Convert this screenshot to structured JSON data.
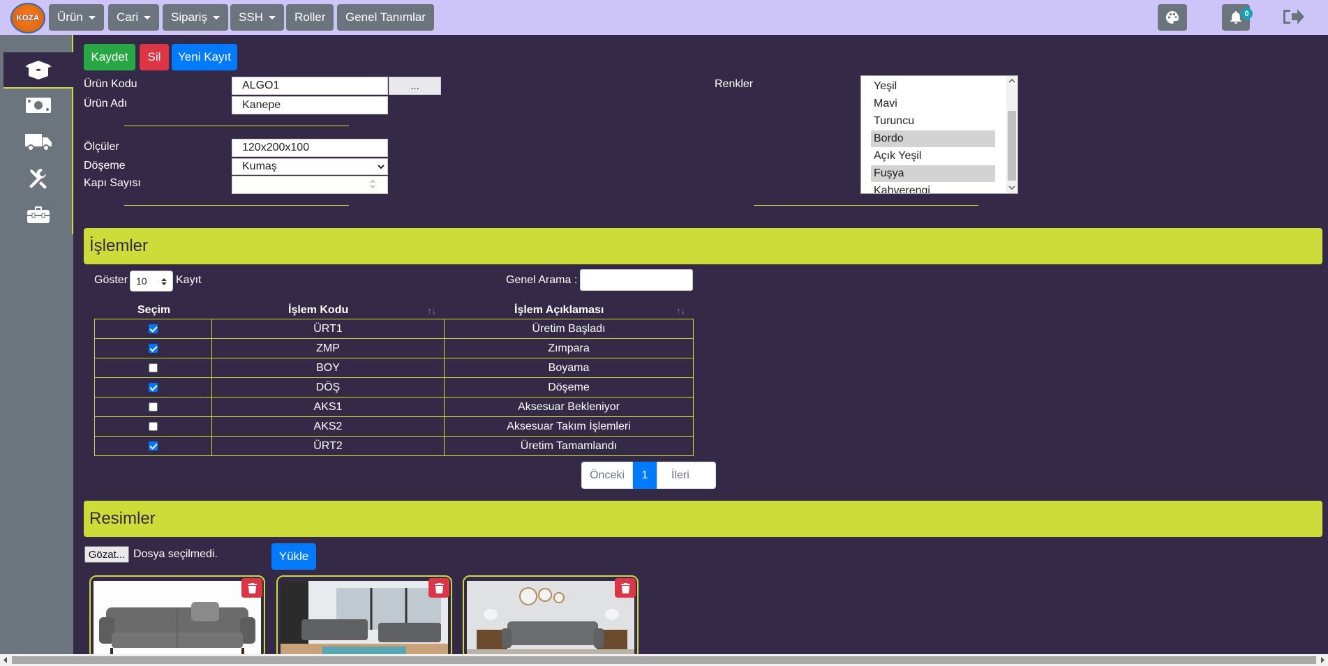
{
  "navbar": {
    "logo_text": "KOZA",
    "menus": [
      {
        "label": "Ürün",
        "dropdown": true
      },
      {
        "label": "Cari",
        "dropdown": true
      },
      {
        "label": "Sipariş",
        "dropdown": true
      },
      {
        "label": "SSH",
        "dropdown": true
      },
      {
        "label": "Roller",
        "dropdown": false
      },
      {
        "label": "Genel Tanımlar",
        "dropdown": false
      }
    ],
    "notification_count": "0",
    "icons": [
      "palette-icon",
      "bell-icon",
      "logout-icon"
    ]
  },
  "sidebar": {
    "items": [
      "box-open-icon",
      "money-bill-icon",
      "truck-icon",
      "tools-icon",
      "toolbox-icon"
    ],
    "active_index": 0
  },
  "toolbar": {
    "save_label": "Kaydet",
    "delete_label": "Sil",
    "new_label": "Yeni Kayıt"
  },
  "form": {
    "product_code_label": "Ürün Kodu",
    "product_code_value": "ALGO1",
    "browse_button": "...",
    "product_name_label": "Ürün Adı",
    "product_name_value": "Kanepe",
    "dimensions_label": "Ölçüler",
    "dimensions_value": "120x200x100",
    "upholstery_label": "Döşeme",
    "upholstery_value": "Kumaş",
    "door_count_label": "Kapı Sayısı",
    "door_count_value": "",
    "colors_label": "Renkler",
    "colors": [
      {
        "label": "Yeşil",
        "selected": false
      },
      {
        "label": "Mavi",
        "selected": false
      },
      {
        "label": "Turuncu",
        "selected": false
      },
      {
        "label": "Bordo",
        "selected": true
      },
      {
        "label": "Açık Yeşil",
        "selected": false
      },
      {
        "label": "Fuşya",
        "selected": true
      },
      {
        "label": "Kahverengi",
        "selected": false
      }
    ]
  },
  "operations": {
    "title": "İşlemler",
    "show_label": "Göster",
    "page_size": "10",
    "records_label": "Kayıt",
    "search_label": "Genel Arama :",
    "search_value": "",
    "columns": [
      "Seçim",
      "İşlem Kodu",
      "İşlem Açıklaması"
    ],
    "rows": [
      {
        "checked": true,
        "code": "ÜRT1",
        "desc": "Üretim Başladı"
      },
      {
        "checked": true,
        "code": "ZMP",
        "desc": "Zımpara"
      },
      {
        "checked": false,
        "code": "BOY",
        "desc": "Boyama"
      },
      {
        "checked": true,
        "code": "DÖŞ",
        "desc": "Döşeme"
      },
      {
        "checked": false,
        "code": "AKS1",
        "desc": "Aksesuar Bekleniyor"
      },
      {
        "checked": false,
        "code": "AKS2",
        "desc": "Aksesuar Takım İşlemleri"
      },
      {
        "checked": true,
        "code": "ÜRT2",
        "desc": "Üretim Tamamlandı"
      }
    ],
    "pager": {
      "prev": "Önceki",
      "current": "1",
      "next": "İleri"
    }
  },
  "images": {
    "title": "Resimler",
    "browse_button": "Gözat...",
    "no_file_text": "Dosya seçilmedi.",
    "upload_button": "Yükle",
    "cards": [
      "sofa-photo",
      "living-room-photo",
      "lounge-photo"
    ]
  },
  "colors": {
    "background": "#342a48",
    "navbar": "#cdc4fa",
    "accent": "#cddc39",
    "save": "#28a745",
    "delete": "#dc3545",
    "new": "#007bff",
    "secondary": "#6c757d"
  }
}
